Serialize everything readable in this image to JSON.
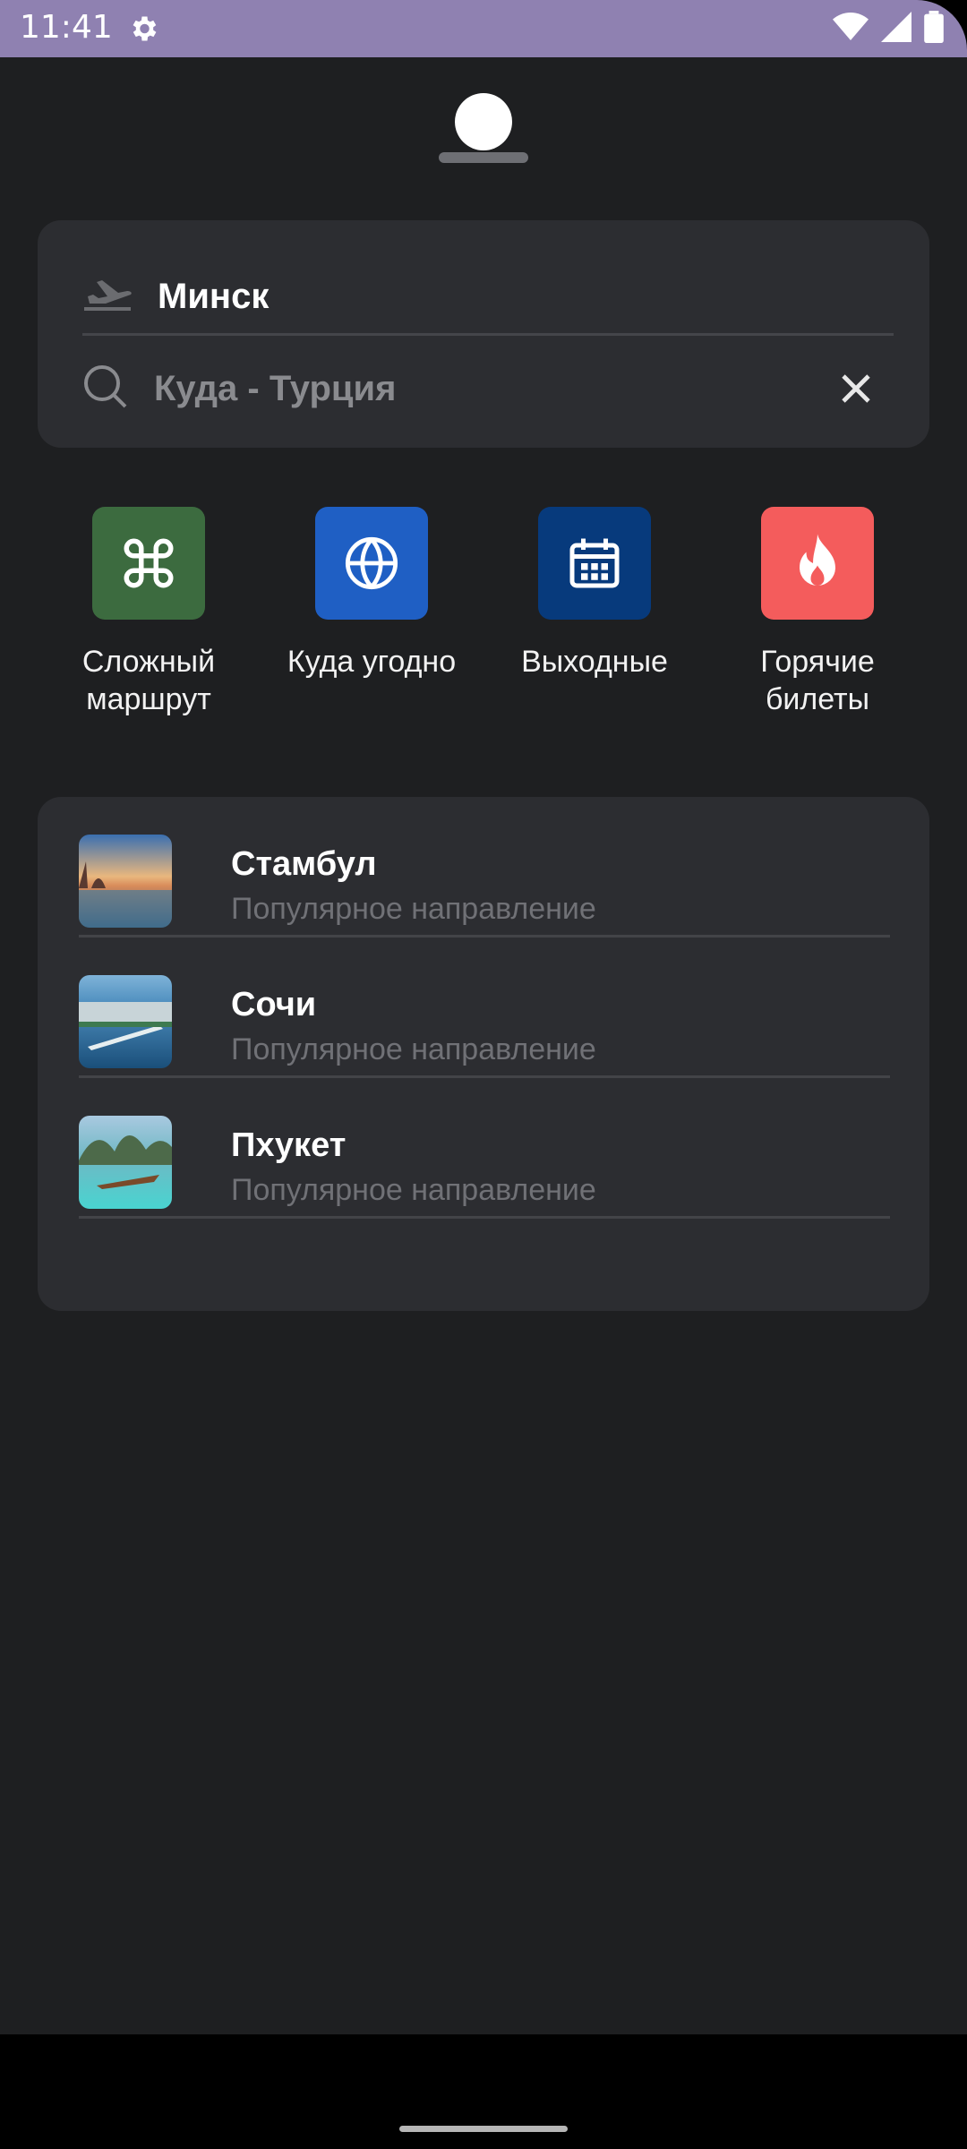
{
  "status_bar": {
    "time": "11:41",
    "icons": [
      "gear-icon",
      "wifi-icon",
      "signal-icon",
      "battery-icon"
    ],
    "background": "#8f81b1"
  },
  "search": {
    "from": "Минск",
    "to_placeholder": "Куда - Турция",
    "icons": [
      "plane-icon",
      "search-icon",
      "close-icon"
    ]
  },
  "quick_actions": [
    {
      "label": "Сложный маршрут",
      "icon": "command-icon",
      "color": "#3c6b3f"
    },
    {
      "label": "Куда угодно",
      "icon": "globe-icon",
      "color": "#1f5fc4"
    },
    {
      "label": "Выходные",
      "icon": "calendar-icon",
      "color": "#073a7c"
    },
    {
      "label": "Горячие билеты",
      "icon": "fire-icon",
      "color": "#f45c5c"
    }
  ],
  "popular": [
    {
      "name": "Стамбул",
      "subtitle": "Популярное направление",
      "image": "istanbul-photo"
    },
    {
      "name": "Сочи",
      "subtitle": "Популярное направление",
      "image": "sochi-photo"
    },
    {
      "name": "Пхукет",
      "subtitle": "Популярное направление",
      "image": "phuket-photo"
    }
  ],
  "colors": {
    "sheet_background": "#1e1f21",
    "card_background": "#2c2d31"
  }
}
